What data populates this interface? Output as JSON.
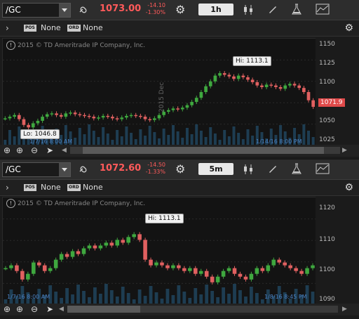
{
  "panes": [
    {
      "symbol": "/GC",
      "price": "1073.00",
      "change": "-14.10",
      "change_pct": "-1.30%",
      "timeframe": "1h",
      "pos_label": "POS",
      "pos_value": "None",
      "ord_label": "ORD",
      "ord_value": "None",
      "copyright": "2015 © TD Ameritrade IP Company, Inc.",
      "y_ticks": [
        "1150",
        "1125",
        "1100",
        "1075",
        "1050",
        "1025"
      ],
      "last_price": "1071.9",
      "hi_label": "Hi: 1113.1",
      "lo_label": "Lo: 1046.8",
      "x_left": "1/7/16 8:00 AM",
      "x_right": "1/14/16 8:00 PM",
      "x_mid": "2015 Dec"
    },
    {
      "symbol": "/GC",
      "price": "1072.60",
      "change": "-14.50",
      "change_pct": "-1.33%",
      "timeframe": "5m",
      "pos_label": "POS",
      "pos_value": "None",
      "ord_label": "ORD",
      "ord_value": "None",
      "copyright": "2015 © TD Ameritrade IP Company, Inc.",
      "y_ticks": [
        "1120",
        "1110",
        "1100",
        "1090"
      ],
      "hi_label": "Hi: 1113.1",
      "x_left": "1/7/16 8:00 AM",
      "x_right": "1/8/16 8:45 PM"
    }
  ],
  "colors": {
    "up": "#3fa83f",
    "down": "#e06060",
    "accent": "#ff5a5a",
    "volume": "#24506e"
  },
  "chart_data": [
    {
      "type": "line",
      "title": "/GC 1h",
      "series": [
        {
          "values": [
            1058,
            1060,
            1062,
            1057,
            1050,
            1047,
            1052,
            1055,
            1060,
            1063,
            1064,
            1062,
            1060,
            1064,
            1065,
            1063,
            1062,
            1061,
            1060,
            1058,
            1059,
            1061,
            1060,
            1058,
            1057,
            1059,
            1061,
            1062,
            1061,
            1060,
            1057,
            1056,
            1058,
            1062,
            1066,
            1068,
            1070,
            1069,
            1071,
            1074,
            1078,
            1083,
            1090,
            1097,
            1103,
            1110,
            1113,
            1111,
            1109,
            1106,
            1110,
            1108,
            1105,
            1102,
            1098,
            1096,
            1099,
            1098,
            1096,
            1094,
            1098,
            1100,
            1098,
            1095,
            1090,
            1080,
            1072
          ]
        }
      ],
      "ylim": [
        1025,
        1155
      ]
    },
    {
      "type": "line",
      "title": "/GC 5m",
      "series": [
        {
          "values": [
            1101,
            1102,
            1100,
            1097,
            1099,
            1103,
            1102,
            1100,
            1101,
            1104,
            1106,
            1105,
            1107,
            1106,
            1108,
            1109,
            1108,
            1109,
            1110,
            1109,
            1111,
            1110,
            1112,
            1113,
            1111,
            1104,
            1102,
            1103,
            1102,
            1101,
            1102,
            1101,
            1100,
            1101,
            1099,
            1100,
            1098,
            1096,
            1098,
            1100,
            1101,
            1099,
            1098,
            1097,
            1099,
            1101,
            1100,
            1102,
            1104,
            1103,
            1102,
            1101,
            1100,
            1099,
            1101,
            1102
          ]
        }
      ],
      "ylim": [
        1088,
        1126
      ]
    }
  ]
}
